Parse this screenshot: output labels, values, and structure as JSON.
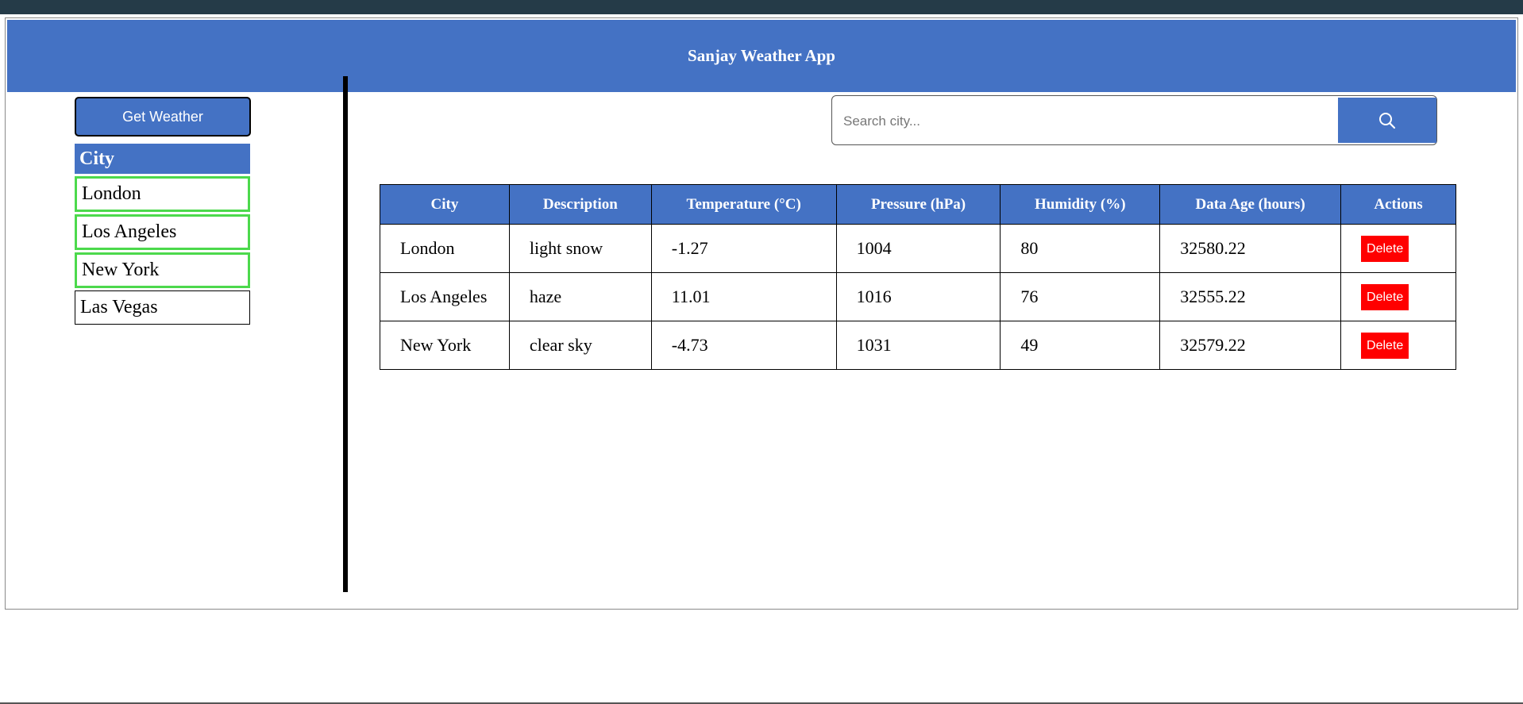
{
  "app": {
    "title": "Sanjay Weather App"
  },
  "sidebar": {
    "get_weather_label": "Get Weather",
    "city_header": "City",
    "cities": [
      "London",
      "Los Angeles",
      "New York",
      "Las Vegas"
    ]
  },
  "search": {
    "placeholder": "Search city...",
    "icon": "search-icon"
  },
  "table": {
    "headers": [
      "City",
      "Description",
      "Temperature (°C)",
      "Pressure (hPa)",
      "Humidity (%)",
      "Data Age (hours)",
      "Actions"
    ],
    "rows": [
      {
        "city": "London",
        "description": "light snow",
        "temperature": "-1.27",
        "pressure": "1004",
        "humidity": "80",
        "age": "32580.22",
        "action": "Delete"
      },
      {
        "city": "Los Angeles",
        "description": "haze",
        "temperature": "11.01",
        "pressure": "1016",
        "humidity": "76",
        "age": "32555.22",
        "action": "Delete"
      },
      {
        "city": "New York",
        "description": "clear sky",
        "temperature": "-4.73",
        "pressure": "1031",
        "humidity": "49",
        "age": "32579.22",
        "action": "Delete"
      }
    ]
  },
  "colors": {
    "accent": "#4472c4",
    "delete": "#ff0000",
    "selected_border": "#4cd94c",
    "topbar": "#253b48"
  }
}
